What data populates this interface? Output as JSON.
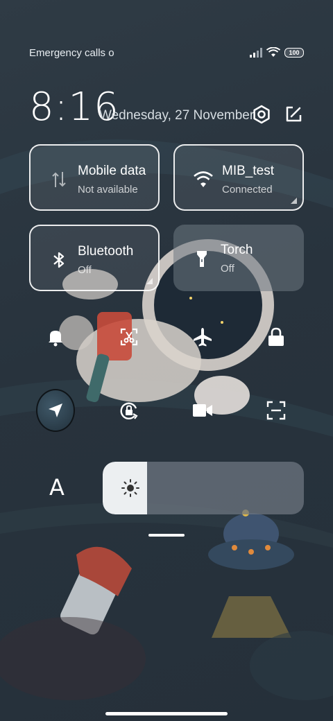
{
  "status_bar": {
    "carrier_text": "Emergency calls o",
    "battery_level": "100"
  },
  "header": {
    "time": "8:16",
    "date": "Wednesday, 27 November"
  },
  "tiles": {
    "mobile_data": {
      "title": "Mobile data",
      "subtitle": "Not available"
    },
    "wifi": {
      "title": "MIB_test",
      "subtitle": "Connected"
    },
    "bluetooth": {
      "title": "Bluetooth",
      "subtitle": "Off"
    },
    "torch": {
      "title": "Torch",
      "subtitle": "Off"
    }
  },
  "quick_toggles": {
    "row1": [
      "bell-icon",
      "screenshot-icon",
      "airplane-icon",
      "lock-icon"
    ],
    "row2": [
      "location-icon",
      "rotation-lock-icon",
      "video-icon",
      "scan-icon"
    ]
  },
  "brightness": {
    "auto_label": "A",
    "level_fraction": 0.22
  },
  "colors": {
    "background": "#2b3640",
    "tile_outline": "#ffffff",
    "tile_fill": "#6e7882",
    "slider_fill": "#eceff1"
  }
}
